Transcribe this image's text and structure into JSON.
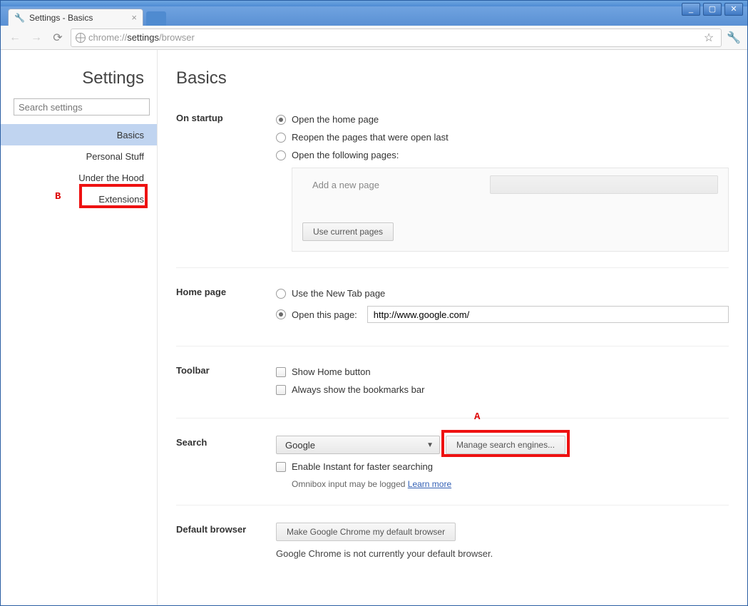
{
  "tab": {
    "title": "Settings - Basics",
    "close": "×"
  },
  "window_controls": {
    "min": "_",
    "max": "▢",
    "close": "✕"
  },
  "omnibox": {
    "prefix": "chrome://",
    "highlight": "settings",
    "suffix": "/browser"
  },
  "sidebar": {
    "title": "Settings",
    "search_placeholder": "Search settings",
    "items": [
      {
        "label": "Basics"
      },
      {
        "label": "Personal Stuff"
      },
      {
        "label": "Under the Hood"
      },
      {
        "label": "Extensions"
      }
    ]
  },
  "main": {
    "title": "Basics",
    "startup": {
      "label": "On startup",
      "opt1": "Open the home page",
      "opt2": "Reopen the pages that were open last",
      "opt3": "Open the following pages:",
      "add_new": "Add a new page",
      "use_current": "Use current pages"
    },
    "homepage": {
      "label": "Home page",
      "opt1": "Use the New Tab page",
      "opt2": "Open this page:",
      "url": "http://www.google.com/"
    },
    "toolbar": {
      "label": "Toolbar",
      "opt1": "Show Home button",
      "opt2": "Always show the bookmarks bar"
    },
    "search": {
      "label": "Search",
      "engine": "Google",
      "manage": "Manage search engines...",
      "instant": "Enable Instant for faster searching",
      "hint": "Omnibox input may be logged ",
      "learn_more": "Learn more"
    },
    "default_browser": {
      "label": "Default browser",
      "button": "Make Google Chrome my default browser",
      "status": "Google Chrome is not currently your default browser."
    }
  },
  "annotations": {
    "A": "A",
    "B": "B"
  }
}
